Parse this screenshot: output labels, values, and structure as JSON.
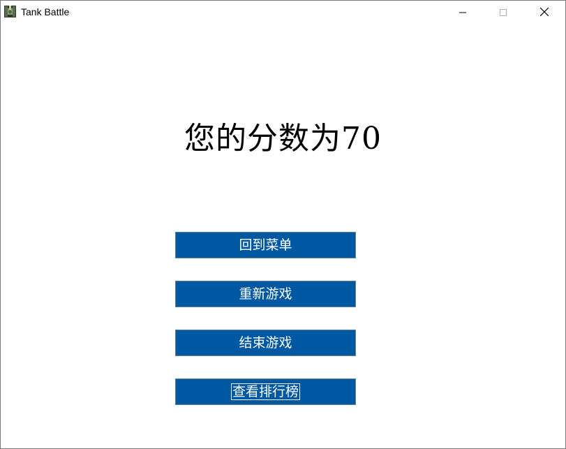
{
  "window": {
    "title": "Tank Battle",
    "icon": "tank-icon",
    "controls": [
      "minimize-icon",
      "maximize-icon",
      "close-icon"
    ]
  },
  "score": {
    "text": "您的分数为70"
  },
  "menu": {
    "buttons": [
      {
        "label": "回到菜单"
      },
      {
        "label": "重新游戏"
      },
      {
        "label": "结束游戏"
      },
      {
        "label": "查看排行榜"
      }
    ]
  },
  "colors": {
    "button_bg": "#0058a3",
    "button_text": "#ffffff",
    "background": "#ffffff"
  }
}
